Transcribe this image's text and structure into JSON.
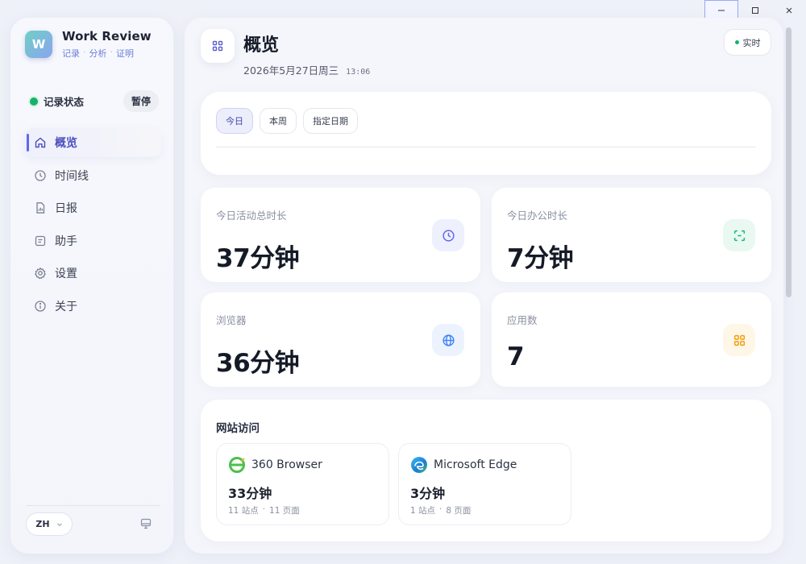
{
  "window_controls": {
    "minimize": "–",
    "maximize": "☐",
    "close": "×"
  },
  "brand": {
    "title": "Work Review",
    "logo_text": "W",
    "sub": [
      "记录",
      "分析",
      "证明"
    ],
    "sep": "·"
  },
  "recording": {
    "label": "记录状态",
    "pause_label": "暂停"
  },
  "nav": [
    {
      "label": "概览",
      "icon": "home-icon",
      "active": true
    },
    {
      "label": "时间线",
      "icon": "clock-icon"
    },
    {
      "label": "日报",
      "icon": "report-icon"
    },
    {
      "label": "助手",
      "icon": "assistant-icon"
    },
    {
      "label": "设置",
      "icon": "gear-icon"
    },
    {
      "label": "关于",
      "icon": "info-icon"
    }
  ],
  "language": {
    "label": "ZH"
  },
  "header": {
    "title": "概览",
    "date": "2026年5月27日周三",
    "time": "13:06",
    "realtime_label": "实时"
  },
  "filters": [
    {
      "label": "今日",
      "active": true
    },
    {
      "label": "本周"
    },
    {
      "label": "指定日期"
    }
  ],
  "stats": [
    {
      "label": "今日活动总时长",
      "value": "37分钟",
      "icon": "clock-icon",
      "color": "#6366f1"
    },
    {
      "label": "今日办公时长",
      "value": "7分钟",
      "icon": "focus-icon",
      "color": "#10b981"
    },
    {
      "label": "浏览器",
      "value": "36分钟",
      "icon": "globe-icon",
      "color": "#3b82f6"
    },
    {
      "label": "应用数",
      "value": "7",
      "icon": "apps-icon",
      "color": "#f59e0b"
    }
  ],
  "sites": {
    "title": "网站访问",
    "browsers": [
      {
        "name": "360 Browser",
        "value": "33分钟",
        "sites": "11 站点",
        "sep": "·",
        "pages": "11 页面",
        "icon": "360-browser-icon"
      },
      {
        "name": "Microsoft Edge",
        "value": "3分钟",
        "sites": "1 站点",
        "sep": "·",
        "pages": "8 页面",
        "icon": "edge-browser-icon"
      }
    ]
  }
}
